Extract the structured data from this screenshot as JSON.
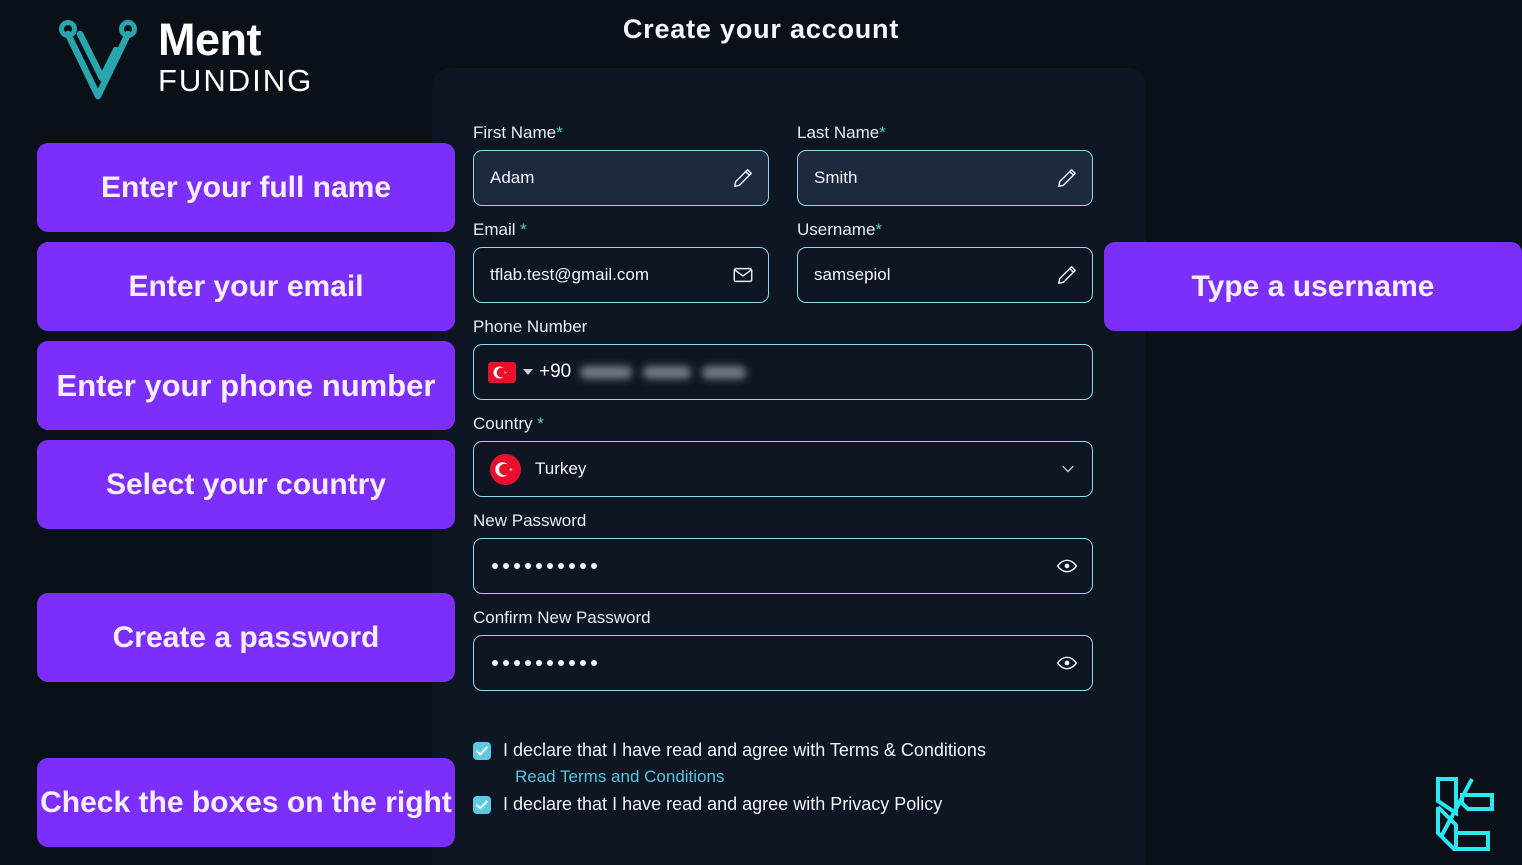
{
  "brand": {
    "name": "Ment",
    "subtitle": "FUNDING",
    "mark_icon": "ment-compass-m-icon",
    "mark_color": "#2aa5ad"
  },
  "header": {
    "title": "Create your account"
  },
  "form": {
    "first_name": {
      "label": "First Name",
      "required_mark": "*",
      "value": "Adam",
      "placeholder": "First Name",
      "icon": "pencil-icon"
    },
    "last_name": {
      "label": "Last Name",
      "required_mark": "*",
      "value": "Smith",
      "placeholder": "Last Name",
      "icon": "pencil-icon"
    },
    "email": {
      "label": "Email ",
      "required_mark": "*",
      "value": "tflab.test@gmail.com",
      "placeholder": "Email",
      "icon": "envelope-icon"
    },
    "username": {
      "label": "Username",
      "required_mark": "*",
      "value": "samsepiol",
      "placeholder": "Username",
      "icon": "pencil-icon"
    },
    "phone": {
      "label": "Phone Number",
      "country_flag": "turkey-flag-rectangle-icon",
      "dial_code": "+90",
      "value_masked": "",
      "dropdown_icon": "caret-down-icon"
    },
    "country": {
      "label": "Country ",
      "required_mark": "*",
      "flag": "turkey-flag-circle-icon",
      "value": "Turkey",
      "dropdown_icon": "chevron-down-icon"
    },
    "new_password": {
      "label": "New Password",
      "value_dots": 10,
      "icon": "eye-icon"
    },
    "confirm_password": {
      "label": "Confirm New Password",
      "value_dots": 10,
      "icon": "eye-icon"
    }
  },
  "agreements": {
    "terms": {
      "checked": true,
      "text": "I declare that I have read and agree with Terms & Conditions",
      "link_text": "Read Terms and Conditions"
    },
    "privacy": {
      "checked": true,
      "text": "I declare that I have read and agree with Privacy Policy"
    }
  },
  "callouts": {
    "full_name": "Enter your full name",
    "email": "Enter your email",
    "phone": "Enter your phone number",
    "country": "Select your country",
    "password": "Create a password",
    "checkboxes": "Check the boxes on the right",
    "username": "Type a username"
  },
  "corner_logo": {
    "icon": "lc-monogram-icon",
    "color": "#2ee6f2"
  },
  "colors": {
    "page_bg": "#0a1018",
    "panel_bg": "#0e1624",
    "accent_purple": "#7c2ffb",
    "accent_teal": "#4fd1c5",
    "field_border": "#8fd8e8",
    "filled_field_bg": "#1d293d",
    "checkbox": "#5fc9e3",
    "link": "#56c4de"
  }
}
